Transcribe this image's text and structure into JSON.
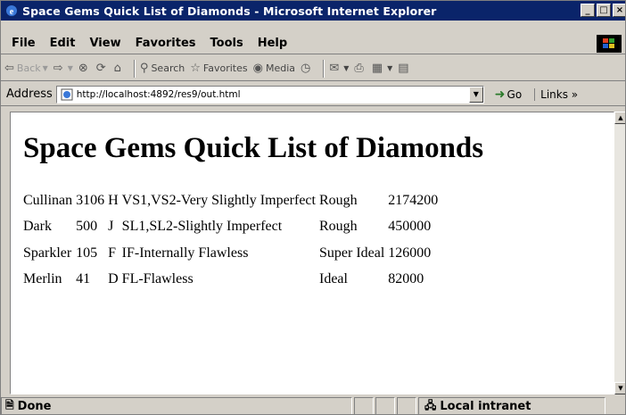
{
  "window": {
    "title": "Space Gems Quick List of Diamonds - Microsoft Internet Explorer",
    "controls": {
      "minimize": "_",
      "maximize": "□",
      "close": "×"
    }
  },
  "menu": [
    "File",
    "Edit",
    "View",
    "Favorites",
    "Tools",
    "Help"
  ],
  "toolbar": {
    "back": "Back",
    "search": "Search",
    "favorites": "Favorites",
    "media": "Media"
  },
  "address": {
    "label": "Address",
    "url": "http://localhost:4892/res9/out.html",
    "go": "Go",
    "links": "Links »"
  },
  "page": {
    "heading": "Space Gems Quick List of Diamonds",
    "rows": [
      {
        "name": "Cullinan",
        "carat": "3106",
        "color": "H",
        "clarity": "VS1,VS2-Very Slightly Imperfect",
        "cut": "Rough",
        "price": "2174200"
      },
      {
        "name": "Dark",
        "carat": "500",
        "color": "J",
        "clarity": "SL1,SL2-Slightly Imperfect",
        "cut": "Rough",
        "price": "450000"
      },
      {
        "name": "Sparkler",
        "carat": "105",
        "color": "F",
        "clarity": "IF-Internally Flawless",
        "cut": "Super Ideal",
        "price": "126000"
      },
      {
        "name": "Merlin",
        "carat": "41",
        "color": "D",
        "clarity": "FL-Flawless",
        "cut": "Ideal",
        "price": "82000"
      }
    ]
  },
  "status": {
    "text": "Done",
    "zone": "Local intranet"
  },
  "colors": {
    "titlebar": "#0a246a",
    "chrome": "#d4d0c8",
    "page_bg": "#ffffff"
  }
}
